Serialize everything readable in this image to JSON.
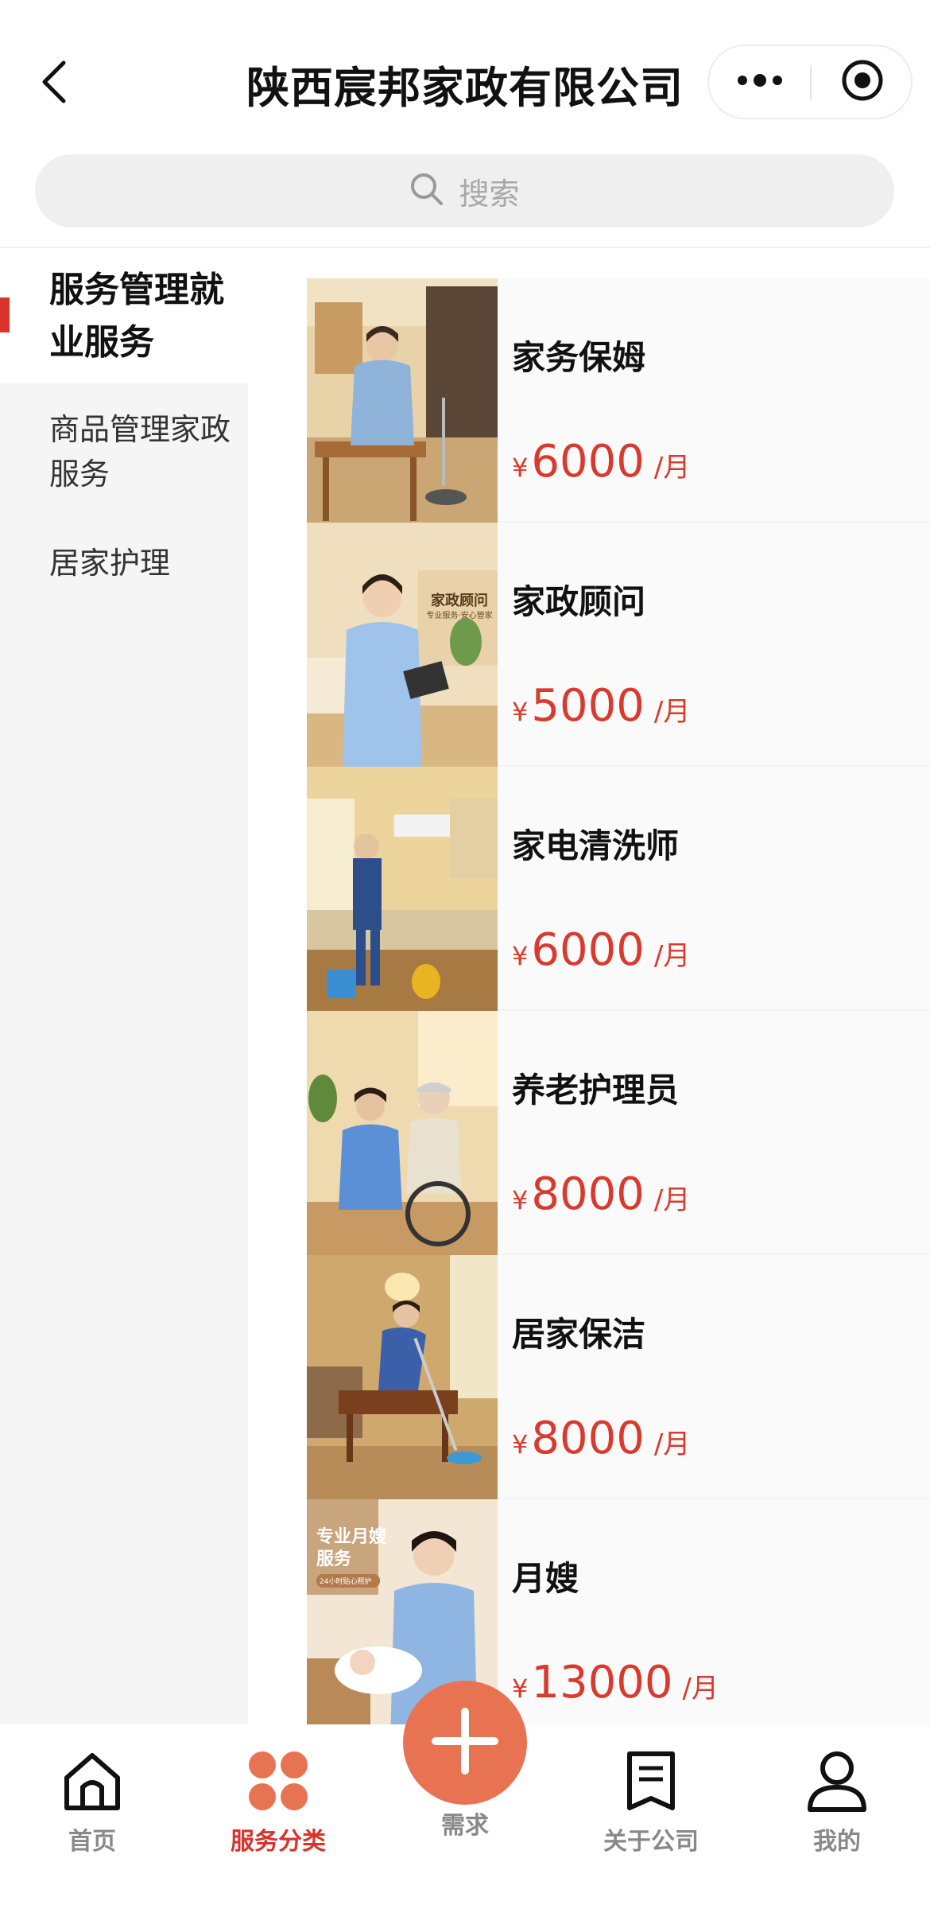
{
  "header": {
    "title": "陕西宸邦家政有限公司",
    "back_icon": "chevron-left-icon",
    "more_icon": "more-dots-icon",
    "target_icon": "target-icon"
  },
  "search": {
    "placeholder": "搜索",
    "icon": "search-icon"
  },
  "sidebar": {
    "items": [
      {
        "label": "服务管理就业服务",
        "active": true
      },
      {
        "label": "商品管理家政服务",
        "active": false
      },
      {
        "label": "居家护理",
        "active": false
      }
    ]
  },
  "products": [
    {
      "name": "家务保姆",
      "currency": "¥",
      "price": "6000",
      "unit": "/月"
    },
    {
      "name": "家政顾问",
      "currency": "¥",
      "price": "5000",
      "unit": "/月",
      "image_text": "家政顾问",
      "image_subtext": "专业服务·安心管家"
    },
    {
      "name": "家电清洗师",
      "currency": "¥",
      "price": "6000",
      "unit": "/月"
    },
    {
      "name": "养老护理员",
      "currency": "¥",
      "price": "8000",
      "unit": "/月"
    },
    {
      "name": "居家保洁",
      "currency": "¥",
      "price": "8000",
      "unit": "/月"
    },
    {
      "name": "月嫂",
      "currency": "¥",
      "price": "13000",
      "unit": "/月",
      "image_text": "专业月嫂服务",
      "image_subtext": "24小时贴心照护"
    }
  ],
  "tabbar": {
    "tabs": [
      {
        "label": "首页",
        "icon": "home-icon",
        "active": false
      },
      {
        "label": "服务分类",
        "icon": "category-icon",
        "active": true
      },
      {
        "label": "需求",
        "icon": "plus-icon",
        "active": false
      },
      {
        "label": "关于公司",
        "icon": "document-icon",
        "active": false
      },
      {
        "label": "我的",
        "icon": "user-icon",
        "active": false
      }
    ]
  },
  "colors": {
    "accent": "#d9342b",
    "price": "#d93a2e",
    "fab": "#e87352",
    "sidebar_bg": "#f5f5f5"
  }
}
